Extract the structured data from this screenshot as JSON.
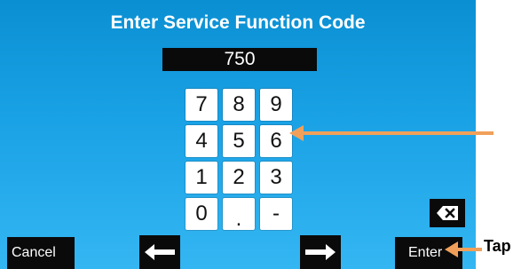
{
  "screen": {
    "title": "Enter Service Function Code",
    "code_value": "750"
  },
  "keypad": {
    "rows": [
      [
        "7",
        "8",
        "9"
      ],
      [
        "4",
        "5",
        "6"
      ],
      [
        "1",
        "2",
        "3"
      ],
      [
        "0",
        ".",
        "-"
      ]
    ]
  },
  "buttons": {
    "cancel_label": "Cancel",
    "enter_label": "Enter",
    "left_icon": "arrow-left-icon",
    "right_icon": "arrow-right-icon",
    "backspace_icon": "backspace-icon"
  },
  "annotations": {
    "tap_label": "Tap",
    "callout_color": "#f0a05a"
  },
  "colors": {
    "screen_top": "#0a8fd2",
    "screen_bottom": "#34b6f2",
    "button_bg": "#0a0a0a"
  }
}
